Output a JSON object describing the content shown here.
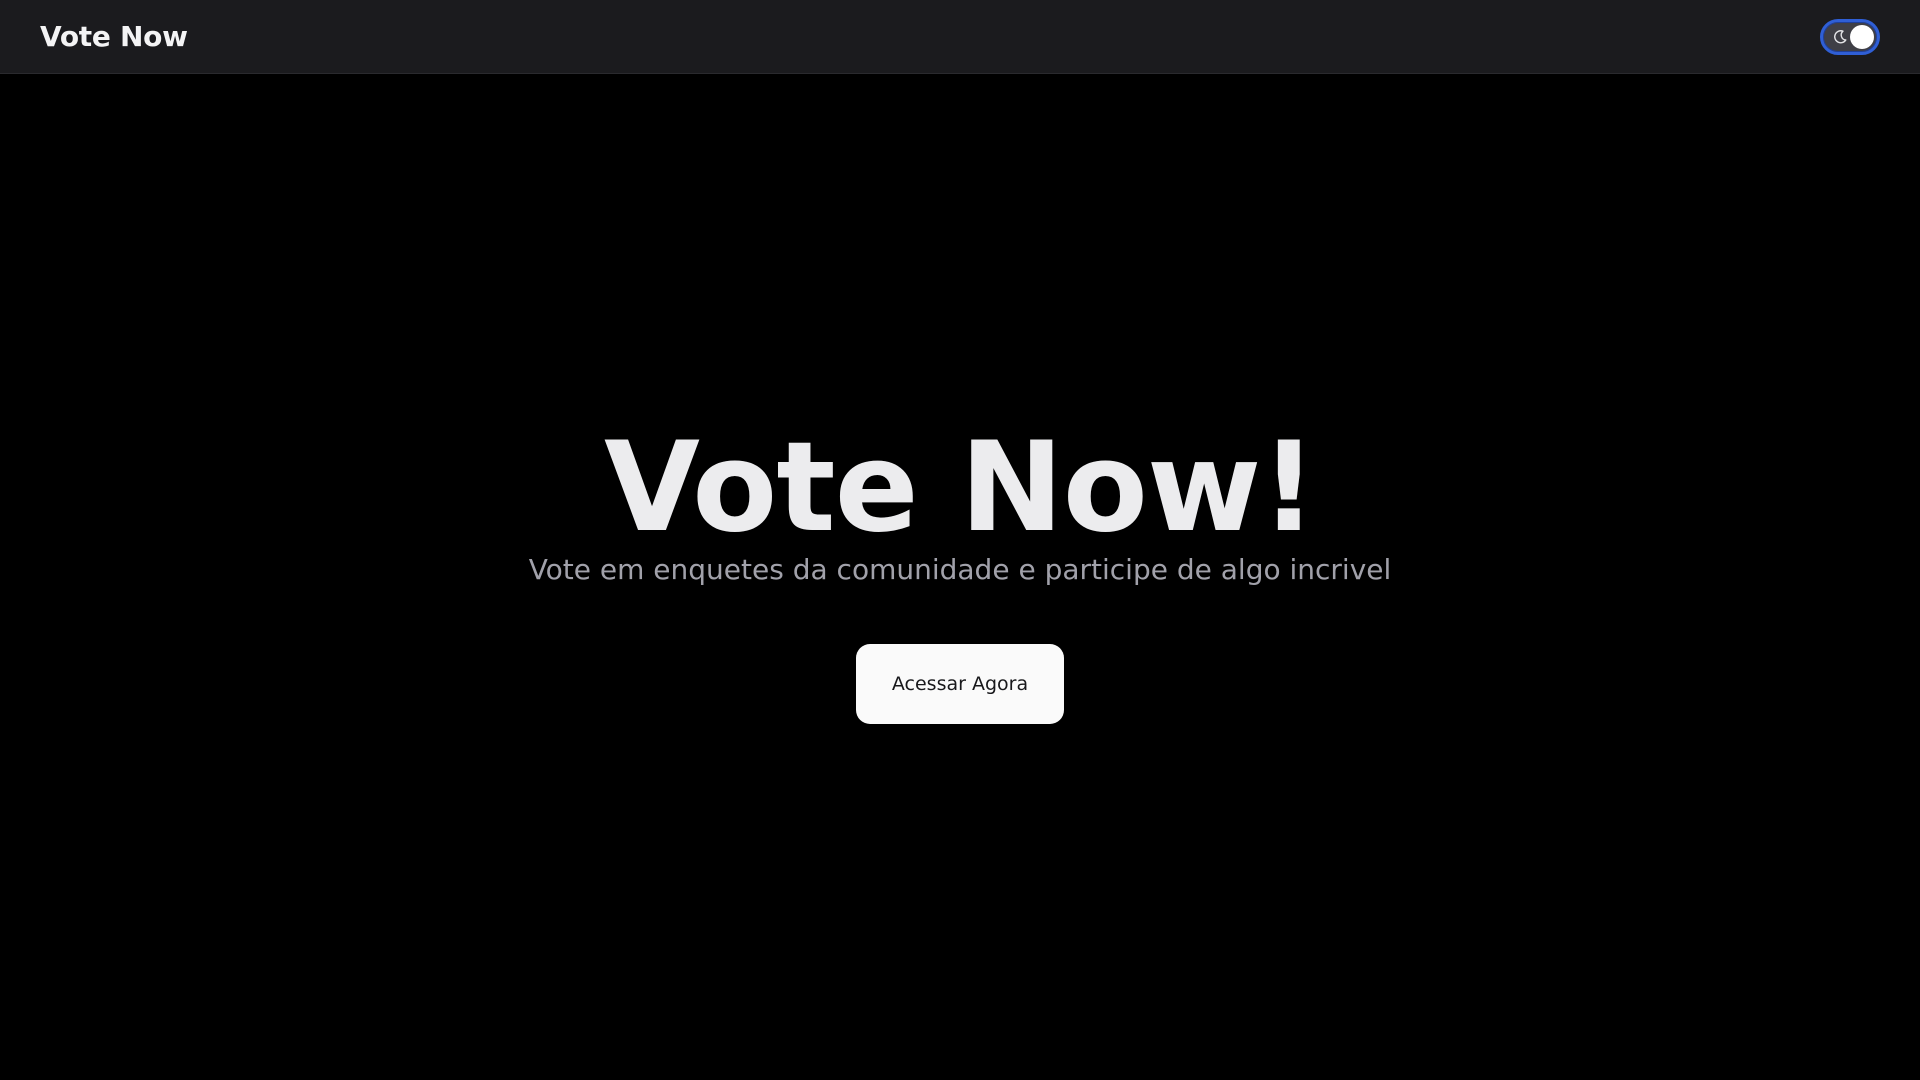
{
  "navbar": {
    "brand": "Vote Now",
    "theme_toggle": {
      "icon": "moon-icon",
      "state": "dark"
    }
  },
  "hero": {
    "title": "Vote Now!",
    "subtitle": "Vote em enquetes da comunidade e participe de algo incrivel",
    "cta_label": "Acessar Agora"
  },
  "colors": {
    "background": "#000000",
    "navbar": "#1b1b1e",
    "toggle_ring": "#2f5fd6",
    "button": "#fafafa"
  }
}
